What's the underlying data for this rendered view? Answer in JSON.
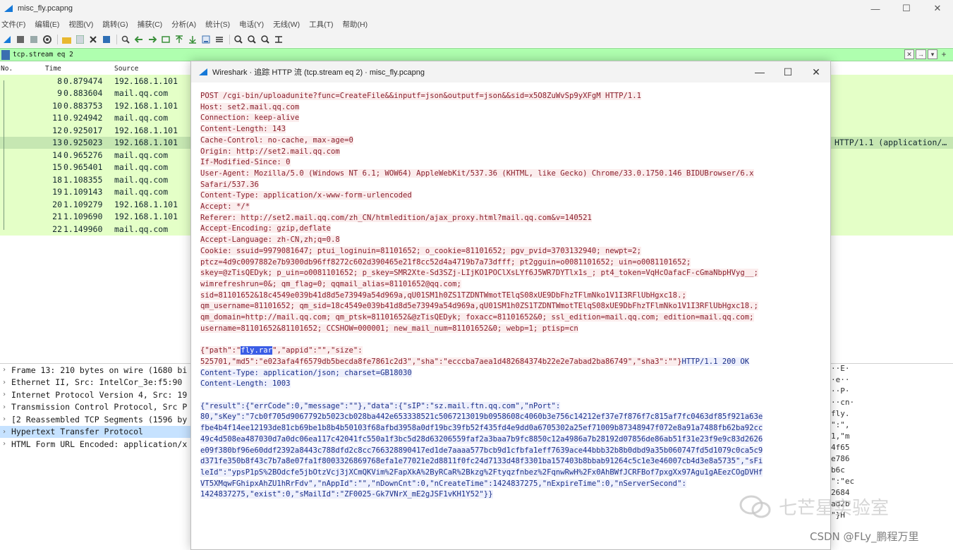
{
  "window": {
    "title": "misc_fly.pcapng",
    "controls": [
      "—",
      "☐",
      "✕"
    ]
  },
  "menu": [
    "文件(F)",
    "编辑(E)",
    "视图(V)",
    "跳转(G)",
    "捕获(C)",
    "分析(A)",
    "统计(S)",
    "电话(Y)",
    "无线(W)",
    "工具(T)",
    "帮助(H)"
  ],
  "filter": {
    "value": "tcp.stream eq 2",
    "plus": "+"
  },
  "packet_list": {
    "headers": {
      "no": "No.",
      "time": "Time",
      "source": "Source"
    },
    "rows": [
      {
        "no": "8",
        "time": "0.879474",
        "src": "192.168.1.101"
      },
      {
        "no": "9",
        "time": "0.883604",
        "src": "mail.qq.com"
      },
      {
        "no": "10",
        "time": "0.883753",
        "src": "192.168.1.101"
      },
      {
        "no": "11",
        "time": "0.924942",
        "src": "mail.qq.com"
      },
      {
        "no": "12",
        "time": "0.925017",
        "src": "192.168.1.101"
      },
      {
        "no": "13",
        "time": "0.925023",
        "src": "192.168.1.101",
        "info": "HTTP/1.1  (application/…"
      },
      {
        "no": "14",
        "time": "0.965276",
        "src": "mail.qq.com"
      },
      {
        "no": "15",
        "time": "0.965401",
        "src": "mail.qq.com"
      },
      {
        "no": "18",
        "time": "1.108355",
        "src": "mail.qq.com"
      },
      {
        "no": "19",
        "time": "1.109143",
        "src": "mail.qq.com"
      },
      {
        "no": "20",
        "time": "1.109279",
        "src": "192.168.1.101"
      },
      {
        "no": "21",
        "time": "1.109690",
        "src": "192.168.1.101"
      },
      {
        "no": "22",
        "time": "1.149960",
        "src": "mail.qq.com"
      }
    ]
  },
  "details": [
    "Frame 13: 210 bytes on wire (1680 bi",
    "Ethernet II, Src: IntelCor_3e:f5:90",
    "Internet Protocol Version 4, Src: 19",
    "Transmission Control Protocol, Src P",
    "[2 Reassembled TCP Segments (1596 by",
    "Hypertext Transfer Protocol",
    "HTML Form URL Encoded: application/x"
  ],
  "bytes_strip": [
    "··E·",
    "·e··",
    "··P·",
    "··cn·",
    "fly.",
    "\":\",",
    "1,\"m",
    "4f65",
    "e786",
    "b6c",
    "\":\"ec",
    "2684",
    "ad2b",
    "\"}H"
  ],
  "dialog": {
    "title": "Wireshark · 追踪 HTTP 流 (tcp.stream eq 2) · misc_fly.pcapng",
    "controls": [
      "—",
      "☐",
      "✕"
    ],
    "request_lines": [
      "POST /cgi-bin/uploadunite?func=CreateFile&&inputf=json&outputf=json&&sid=x5O8ZuWvSp9yXFgM HTTP/1.1",
      "Host: set2.mail.qq.com",
      "Connection: keep-alive",
      "Content-Length: 143",
      "Cache-Control: no-cache, max-age=0",
      "Origin: http://set2.mail.qq.com",
      "If-Modified-Since: 0",
      "User-Agent: Mozilla/5.0 (Windows NT 6.1; WOW64) AppleWebKit/537.36 (KHTML, like Gecko) Chrome/33.0.1750.146 BIDUBrowser/6.x",
      "Safari/537.36",
      "Content-Type: application/x-www-form-urlencoded",
      "Accept: */*",
      "Referer: http://set2.mail.qq.com/zh_CN/htmledition/ajax_proxy.html?mail.qq.com&v=140521",
      "Accept-Encoding: gzip,deflate",
      "Accept-Language: zh-CN,zh;q=0.8",
      "Cookie: ssuid=9979081647; ptui_loginuin=81101652; o_cookie=81101652; pgv_pvid=3703132940; newpt=2;",
      "ptcz=4d9c0097882e7b9300db96ff8272c602d390465e21f8cc52d4a4719b7a73dfff; pt2gguin=o0081101652; uin=o0081101652;",
      "skey=@zTisQEDyk; p_uin=o0081101652; p_skey=SMR2Xte-Sd3SZj-LIjKO1POClXsLYf6J5WR7DYTlx1s_; pt4_token=VqHcOafacF-cGmaNbpHVyg__;",
      "wimrefreshrun=0&; qm_flag=0; qqmail_alias=81101652@qq.com;",
      "sid=81101652&18c4549e039b41d8d5e73949a54d969a,qU01SM1h0ZS1TZDNTWmotTElqS08xUE9DbFhzTFlmNko1V1I3RFlUbHgxc18.;",
      "qm_username=81101652; qm_sid=18c4549e039b41d8d5e73949a54d969a,qU01SM1h0ZS1TZDNTWmotTElqS08xUE9DbFhzTFlmNko1V1I3RFlUbHgxc18.;",
      "qm_domain=http://mail.qq.com; qm_ptsk=81101652&@zTisQEDyk; foxacc=81101652&0; ssl_edition=mail.qq.com; edition=mail.qq.com;",
      "username=81101652&81101652; CCSHOW=000001; new_mail_num=81101652&0; webp=1; ptisp=cn"
    ],
    "body_prefix": "{\"path\":\"",
    "body_highlight": "fly.rar",
    "body_after": "\",\"appid\":\"\",\"size\":",
    "body_line2": "525701,\"md5\":\"e023afa4f6579db5becda8fe7861c2d3\",\"sha\":\"ecccba7aea1d482684374b22e2e7abad2ba86749\",\"sha3\":\"\"}",
    "resp_status": "HTTP/1.1 200 OK",
    "resp_headers": [
      "Content-Type: application/json; charset=GB18030",
      "Content-Length: 1003"
    ],
    "resp_body": [
      "{\"result\":{\"errCode\":0,\"message\":\"\"},\"data\":{\"sIP\":\"sz.mail.ftn.qq.com\",\"nPort\":",
      "80,\"sKey\":\"7cb0f705d9067792b5023cb028ba442e653338521c5067213019b0958608c4060b3e756c14212ef37e7f876f7c815af7fc0463df85f921a63e",
      "fbe4b4f14ee12193de81cb69be1b8b4b50103f68afbd3958a0df19bc39fb52f435fd4e9dd0a6705302a25ef71009b87348947f072e8a91a7488fb62ba92cc",
      "49c4d508ea487030d7a0dc06ea117c42041fc550a1f3bc5d28d63206559faf2a3baa7b9fc8850c12a4986a7b28192d07856de86ab51f31e23f9e9c83d2626",
      "e09f380bf96e60ddf2392a8443c788dfd2c8cc766328890417ed1de7aaaa577bcb9d1cfbfa1eff7639ace44bbb32b8b0dbd9a35b060747fd5d1079c0ca5c9",
      "d371fe350b8f43c7b7a8e07fa1f8003326869768efa1e77021e2d8811f0fc24d7133d48f3301ba157403b8bbab91264c5c1e3e46007cb4d3e8a5735\",\"sFi",
      "leId\":\"ypsP1pS%2BOdcfe5jbOtzVcj3jXCmQKVim%2FapXkA%2ByRCaR%2Bkzg%2Ftyqzfnbez%2FqnwRwH%2Fx0AhBWfJCRFBof7pxgXx97Agu1gAEezCOgDVHf",
      "VT5XMqwFGhipxAhZU1hRrFdv\",\"nAppId\":\"\",\"nDownCnt\":0,\"nCreateTime\":1424837275,\"nExpireTime\":0,\"nServerSecond\":",
      "1424837275,\"exist\":0,\"sMailId\":\"ZF0025-Gk7VNrX_mE2gJSF1vKH1Y52\"}}"
    ]
  },
  "watermarks": {
    "brand": "七芒星实验室",
    "author": "CSDN @FLy_鹏程万里"
  },
  "colors": {
    "filter_bg": "#afffaf",
    "row_bg": "#e4ffc7",
    "client_text": "#8a1f2c",
    "server_text": "#1a2f8a",
    "highlight": "#3a5de6"
  }
}
